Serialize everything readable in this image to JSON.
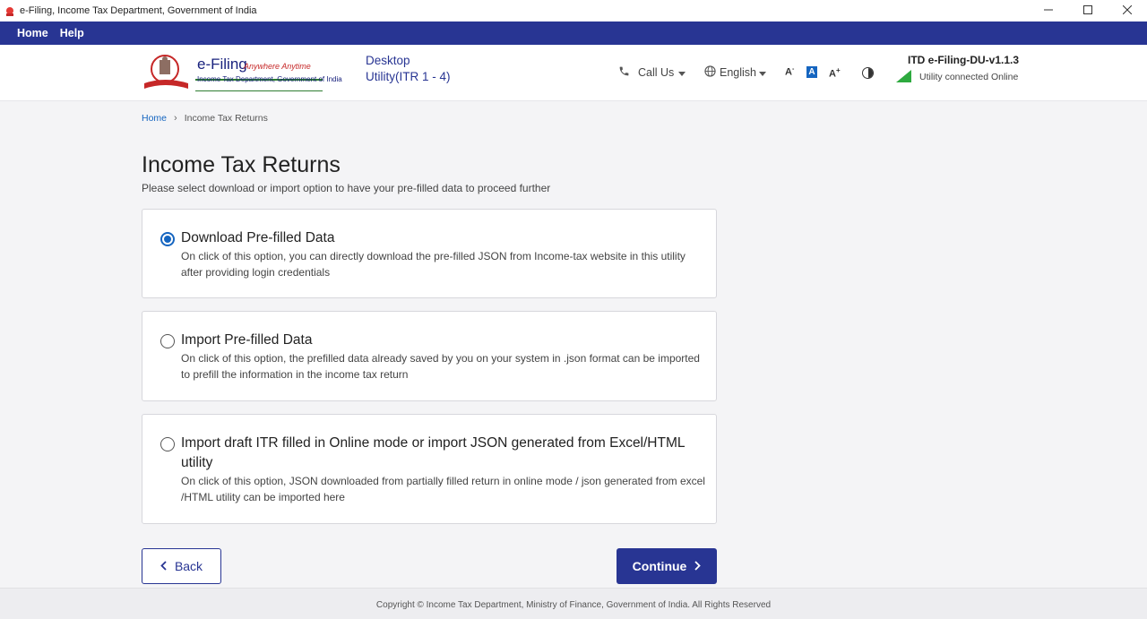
{
  "window": {
    "title": "e-Filing, Income Tax Department, Government of India",
    "minimize_icon": "minimize-icon",
    "maximize_icon": "maximize-icon",
    "close_icon": "close-icon"
  },
  "menubar": {
    "items": [
      "Home",
      "Help"
    ]
  },
  "header": {
    "brand_title": "e-Filing",
    "brand_tagline": "Anywhere Anytime",
    "brand_subtitle": "Income Tax Department, Government of India",
    "utility_name": "Desktop Utility(ITR 1 - 4)",
    "call_us": "Call Us",
    "language": "English",
    "font_decrease": "A",
    "font_default": "A",
    "font_increase": "A",
    "version": "ITD e-Filing-DU-v1.1.3",
    "connection_status": "Utility connected Online",
    "accent_color": "#283593",
    "status_color": "#2eaa3f"
  },
  "breadcrumb": {
    "home": "Home",
    "current": "Income Tax Returns"
  },
  "page": {
    "title": "Income Tax Returns",
    "subtitle": "Please select download or import option to have your pre-filled data to proceed further"
  },
  "options": [
    {
      "title": "Download Pre-filled Data",
      "description": "On click of this option, you can directly download the pre-filled JSON from Income-tax website in this utility after providing login credentials",
      "selected": true
    },
    {
      "title": "Import Pre-filled Data",
      "description": "On click of this option, the prefilled data already saved by you on your system in .json format can be imported to prefill the information in the income tax return",
      "selected": false
    },
    {
      "title": "Import draft ITR filled in Online mode or import JSON generated from Excel/HTML utility",
      "description": "On click of this option, JSON downloaded from partially filled return in online mode / json generated from excel /HTML utility can be imported here",
      "selected": false
    }
  ],
  "buttons": {
    "back": "Back",
    "continue": "Continue"
  },
  "footer": {
    "copyright": "Copyright © Income Tax Department, Ministry of Finance, Government of India. All Rights Reserved"
  }
}
